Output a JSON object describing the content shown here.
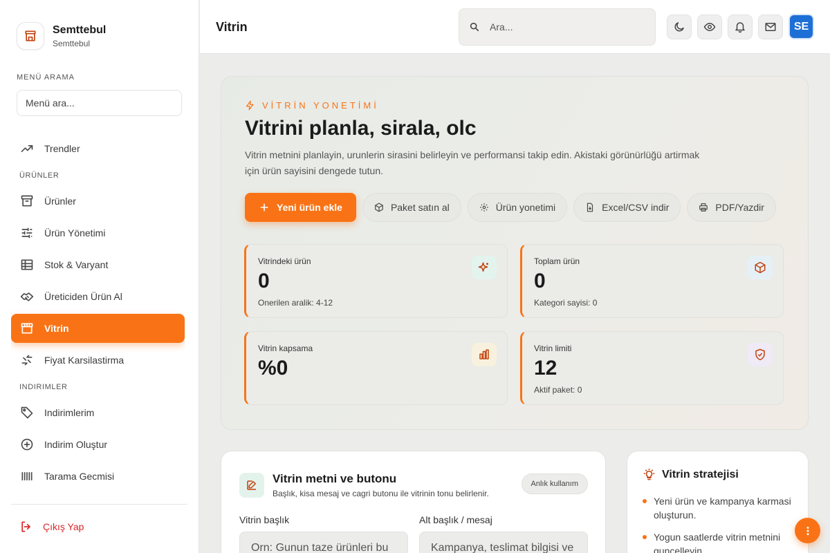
{
  "brand": {
    "name": "Semttebul",
    "sub": "Semttebul",
    "logo_icon": "store-icon"
  },
  "menu_search": {
    "label": "MENÜ ARAMA",
    "placeholder": "Menü ara..."
  },
  "nav": {
    "trends": "Trendler",
    "section_products": "ÜRÜNLER",
    "products": "Ürünler",
    "product_management": "Ürün Yönetimi",
    "stock_variant": "Stok & Varyant",
    "from_producer": "Üreticiden Ürün Al",
    "showcase": "Vitrin",
    "price_compare": "Fiyat Karsilastirma",
    "section_discounts": "INDIRIMLER",
    "my_discounts": "Indirimlerim",
    "create_discount": "Indirim Oluştur",
    "partial_item": "Tarama Gecmisi"
  },
  "logout": "Çıkış Yap",
  "header": {
    "title": "Vitrin",
    "search_placeholder": "Ara...",
    "avatar": "SE"
  },
  "hero": {
    "kicker": "VİTRİN YONETİMİ",
    "title": "Vitrini planla, sirala, olc",
    "description": "Vitrin metnini planlayin, urunlerin sirasini belirleyin ve performansi takip edin. Akistaki görünürlüğü artirmak için ürün sayisini dengede tutun.",
    "actions": {
      "add": "Yeni ürün ekle",
      "buy_package": "Paket satın al",
      "manage": "Ürün yonetimi",
      "export": "Excel/CSV indir",
      "print": "PDF/Yazdir"
    }
  },
  "stats": {
    "in_showcase": {
      "label": "Vitrindeki ürün",
      "value": "0",
      "sub": "Onerilen aralik: 4-12"
    },
    "total": {
      "label": "Toplam ürün",
      "value": "0",
      "sub": "Kategori sayisi: 0"
    },
    "coverage": {
      "label": "Vitrin kapsama",
      "value": "%0"
    },
    "limit": {
      "label": "Vitrin limiti",
      "value": "12",
      "sub": "Aktif paket: 0"
    }
  },
  "text_card": {
    "title": "Vitrin metni ve butonu",
    "subtitle": "Başlık, kisa mesaj ve cagri butonu ile vitrinin tonu belirlenir.",
    "pill": "Anlık kullanım",
    "title_label": "Vitrin başlık",
    "title_placeholder": "Orn: Gunun taze ürünleri bu",
    "message_label": "Alt başlık / mesaj",
    "message_placeholder": "Kampanya, teslimat bilgisi ve"
  },
  "strategy": {
    "title": "Vitrin stratejisi",
    "tips": [
      "Yeni ürün ve kampanya karmasi oluşturun.",
      "Yogun saatlerde vitrin metnini guncelleyin."
    ]
  },
  "colors": {
    "accent": "#f97316",
    "avatar": "#1d6fd6",
    "danger": "#dc2626"
  }
}
